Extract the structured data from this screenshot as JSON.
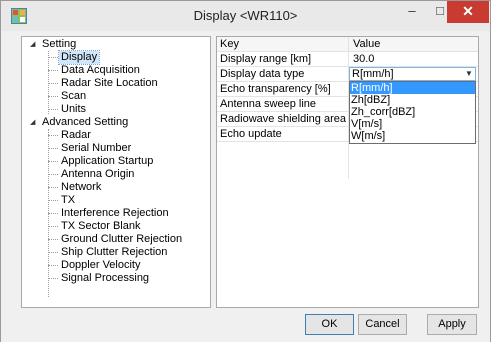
{
  "window": {
    "title": "Display <WR110>",
    "minimize_label": "–",
    "maximize_label": "□",
    "close_label": "✕"
  },
  "tree": {
    "setting": {
      "label": "Setting",
      "children": [
        "Display",
        "Data Acquisition",
        "Radar Site Location",
        "Scan",
        "Units"
      ]
    },
    "advanced": {
      "label": "Advanced Setting",
      "children": [
        "Radar",
        "Serial Number",
        "Application Startup",
        "Antenna Origin",
        "Network",
        "TX",
        "Interference Rejection",
        "TX Sector Blank",
        "Ground Clutter Rejection",
        "Ship Clutter Rejection",
        "Doppler Velocity",
        "Signal Processing"
      ]
    },
    "selected": "Display"
  },
  "grid": {
    "columns": [
      "Key",
      "Value"
    ],
    "rows": [
      {
        "key": "Display range [km]",
        "value": "30.0"
      },
      {
        "key": "Display data type",
        "value": "R[mm/h]"
      },
      {
        "key": "Echo transparency [%]",
        "value": ""
      },
      {
        "key": "Antenna sweep line",
        "value": ""
      },
      {
        "key": "Radiowave shielding area",
        "value": ""
      },
      {
        "key": "Echo update",
        "value": ""
      }
    ]
  },
  "dropdown": {
    "options": [
      "R[mm/h]",
      "Zh[dBZ]",
      "Zh_corr[dBZ]",
      "V[m/s]",
      "W[m/s]"
    ],
    "selected": "R[mm/h]"
  },
  "footer": {
    "ok_label": "OK",
    "cancel_label": "Cancel",
    "apply_label": "Apply"
  },
  "colors": {
    "selection": "#3399ff",
    "close_button": "#c93a31",
    "tree_selection": "#cfe6fb"
  }
}
